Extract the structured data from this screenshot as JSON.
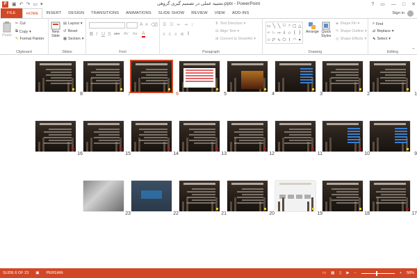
{
  "window": {
    "title": "تشبیه عملی در تصمیم گیری گروهی.pptx - PowerPoint",
    "app_icon": "P",
    "help": "?",
    "minimize": "—",
    "maximize": "□",
    "close": "✕"
  },
  "tabs": [
    {
      "label": "FILE"
    },
    {
      "label": "HOME"
    },
    {
      "label": "INSERT"
    },
    {
      "label": "DESIGN"
    },
    {
      "label": "TRANSITIONS"
    },
    {
      "label": "ANIMATIONS"
    },
    {
      "label": "SLIDE SHOW"
    },
    {
      "label": "REVIEW"
    },
    {
      "label": "VIEW"
    },
    {
      "label": "ADD-INS"
    }
  ],
  "signin": "Sign in",
  "ribbon": {
    "clipboard": {
      "label": "Clipboard",
      "paste": "Paste",
      "cut": "Cut",
      "copy": "Copy",
      "format_painter": "Format Painter"
    },
    "slides": {
      "label": "Slides",
      "new_slide": "New",
      "new_slide_2": "Slide",
      "layout": "Layout",
      "reset": "Reset",
      "section": "Section"
    },
    "font": {
      "label": "Font",
      "bold": "B",
      "italic": "I",
      "underline": "U",
      "strike": "S",
      "abc": "abc",
      "av": "AV",
      "aa": "Aa",
      "font_color": "A",
      "grow": "A",
      "shrink": "A"
    },
    "paragraph": {
      "label": "Paragraph",
      "text_direction": "Text Direction",
      "align_text": "Align Text",
      "convert_smartart": "Convert to SmartArt"
    },
    "drawing": {
      "label": "Drawing",
      "arrange": "Arrange",
      "quick_styles": "Quick",
      "quick_styles_2": "Styles",
      "shape_fill": "Shape Fill",
      "shape_outline": "Shape Outline",
      "shape_effects": "Shape Effects"
    },
    "editing": {
      "label": "Editing",
      "find": "Find",
      "replace": "Replace",
      "select": "Select"
    }
  },
  "slides": [
    {
      "num": "1",
      "kind": "dark",
      "mark": "star"
    },
    {
      "num": "2",
      "kind": "dark",
      "mark": "star"
    },
    {
      "num": "3",
      "kind": "list",
      "mark": "star"
    },
    {
      "num": "4",
      "kind": "scene",
      "mark": "star"
    },
    {
      "num": "5",
      "kind": "table",
      "mark": "star"
    },
    {
      "num": "6",
      "kind": "dark",
      "mark": "star",
      "selected": true
    },
    {
      "num": "7",
      "kind": "dark",
      "mark": "star"
    },
    {
      "num": "8",
      "kind": "dark",
      "mark": "star"
    },
    {
      "num": "9",
      "kind": "list",
      "mark": "star"
    },
    {
      "num": "10",
      "kind": "list",
      "mark": "red"
    },
    {
      "num": "11",
      "kind": "dark",
      "mark": "red"
    },
    {
      "num": "12",
      "kind": "dark",
      "mark": "red"
    },
    {
      "num": "13",
      "kind": "dark",
      "mark": "red"
    },
    {
      "num": "14",
      "kind": "dark",
      "mark": "red"
    },
    {
      "num": "15",
      "kind": "dark",
      "mark": "red"
    },
    {
      "num": "16",
      "kind": "dark",
      "mark": "red"
    },
    {
      "num": "17",
      "kind": "dark",
      "mark": "red"
    },
    {
      "num": "18",
      "kind": "dark",
      "mark": "star"
    },
    {
      "num": "19",
      "kind": "white",
      "mark": "star"
    },
    {
      "num": "20",
      "kind": "dark",
      "mark": "star"
    },
    {
      "num": "21",
      "kind": "dark",
      "mark": "star"
    },
    {
      "num": "22",
      "kind": "blue",
      "mark": "none"
    },
    {
      "num": "23",
      "kind": "photo",
      "mark": "none"
    }
  ],
  "status": {
    "slide_of": "SLIDE 6 OF 23",
    "language": "PERSIAN",
    "zoom": "58%",
    "zoom_minus": "−",
    "zoom_plus": "+"
  },
  "colors": {
    "accent": "#d24726",
    "selected_outline": "#d24726",
    "star_marker": "#ffd400",
    "red_marker": "#d20000"
  }
}
